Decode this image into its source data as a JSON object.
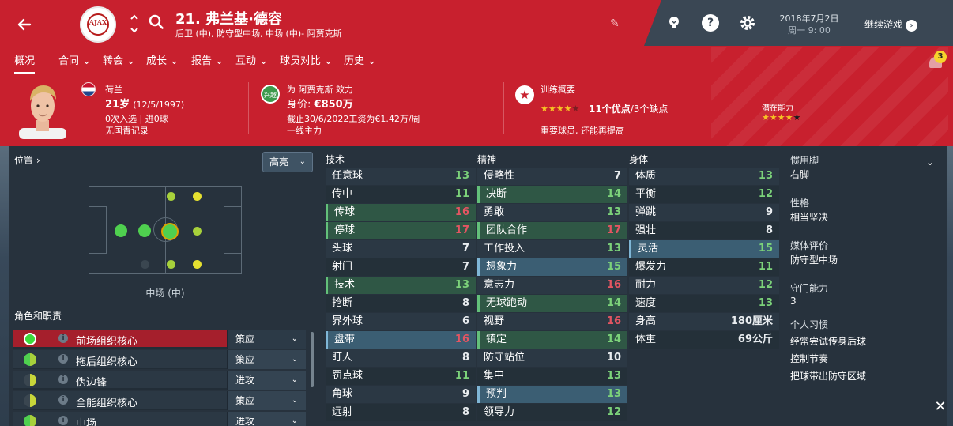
{
  "header": {
    "player_title": "21. 弗兰基·德容",
    "positions": "后卫 (中), 防守型中场, 中场 (中)- 阿贾克斯",
    "club_crest_text": "AJAX",
    "date": "2018年7月2日",
    "time": "周一 9: 00",
    "continue_label": "继续游戏",
    "notification_count": "3"
  },
  "nav": {
    "tabs": [
      {
        "label": "概况"
      },
      {
        "label": "合同"
      },
      {
        "label": "转会"
      },
      {
        "label": "成长"
      },
      {
        "label": "报告"
      },
      {
        "label": "互动"
      },
      {
        "label": "球员对比"
      },
      {
        "label": "历史"
      }
    ],
    "dropdown_glyph": "⌄"
  },
  "profile": {
    "nationality": "荷兰",
    "age": "21岁",
    "birth": "(12/5/1997)",
    "caps": "0次入选 | 进0球",
    "intl_record": "无国青记录",
    "plays_for": "为 阿贾克斯 效力",
    "value_label": "身价:",
    "value": "€850万",
    "contract": "截止30/6/2022工资为€1.42万/周",
    "squad_status": "一线主力",
    "club_badge_text": "兴趣",
    "training_label": "训练概要",
    "strengths": "11个优点",
    "weaknesses": "/3个缺点",
    "strength_stars": 4,
    "training_note": "重要球员, 还能再提高",
    "potential_label": "潜在能力",
    "potential_stars": 4
  },
  "left": {
    "position_label": "位置",
    "highlight_label": "高亮",
    "position_name": "中场 (中)",
    "roles_title": "角色和职责",
    "roles": [
      {
        "name": "前场组织核心",
        "duty": "策应"
      },
      {
        "name": "拖后组织核心",
        "duty": "策应"
      },
      {
        "name": "伪边锋",
        "duty": "进攻"
      },
      {
        "name": "全能组织核心",
        "duty": "策应"
      },
      {
        "name": "中场",
        "duty": "进攻"
      }
    ]
  },
  "columns": {
    "technical": "技术",
    "mental": "精神",
    "physical": "身体"
  },
  "technical": [
    {
      "name": "任意球",
      "value": "13"
    },
    {
      "name": "传中",
      "value": "11"
    },
    {
      "name": "传球",
      "value": "16"
    },
    {
      "name": "停球",
      "value": "17"
    },
    {
      "name": "头球",
      "value": "7"
    },
    {
      "name": "射门",
      "value": "7"
    },
    {
      "name": "技术",
      "value": "13"
    },
    {
      "name": "抢断",
      "value": "8"
    },
    {
      "name": "界外球",
      "value": "6"
    },
    {
      "name": "盘带",
      "value": "16"
    },
    {
      "name": "盯人",
      "value": "8"
    },
    {
      "name": "罚点球",
      "value": "11"
    },
    {
      "name": "角球",
      "value": "9"
    },
    {
      "name": "远射",
      "value": "8"
    }
  ],
  "mental": [
    {
      "name": "侵略性",
      "value": "7"
    },
    {
      "name": "决断",
      "value": "14"
    },
    {
      "name": "勇敢",
      "value": "13"
    },
    {
      "name": "团队合作",
      "value": "17"
    },
    {
      "name": "工作投入",
      "value": "13"
    },
    {
      "name": "想象力",
      "value": "15"
    },
    {
      "name": "意志力",
      "value": "16"
    },
    {
      "name": "无球跑动",
      "value": "14"
    },
    {
      "name": "视野",
      "value": "16"
    },
    {
      "name": "镇定",
      "value": "14"
    },
    {
      "name": "防守站位",
      "value": "10"
    },
    {
      "name": "集中",
      "value": "13"
    },
    {
      "name": "预判",
      "value": "13"
    },
    {
      "name": "领导力",
      "value": "12"
    }
  ],
  "physical": [
    {
      "name": "体质",
      "value": "13"
    },
    {
      "name": "平衡",
      "value": "12"
    },
    {
      "name": "弹跳",
      "value": "9"
    },
    {
      "name": "强壮",
      "value": "8"
    },
    {
      "name": "灵活",
      "value": "15"
    },
    {
      "name": "爆发力",
      "value": "11"
    },
    {
      "name": "耐力",
      "value": "12"
    },
    {
      "name": "速度",
      "value": "13"
    },
    {
      "name": "身高",
      "value": "180厘米"
    },
    {
      "name": "体重",
      "value": "69公斤"
    }
  ],
  "right": {
    "foot_label": "惯用脚",
    "foot_value": "右脚",
    "personality_label": "性格",
    "personality_value": "相当坚决",
    "media_label": "媒体评价",
    "media_value": "防守型中场",
    "gk_label": "守门能力",
    "gk_value": "3",
    "habits_label": "个人习惯",
    "habits": [
      "经常尝试传身后球",
      "控制节奏",
      "把球带出防守区域"
    ]
  },
  "colors": {
    "accent_red": "#c8202e",
    "good": "#7cd27a",
    "great": "#e35562",
    "panel": "#27323d"
  },
  "icons": [
    "back-arrow-icon",
    "up-down-icon",
    "search-icon",
    "pencil-icon",
    "lightbulb-icon",
    "help-icon",
    "gear-icon",
    "chevron-right-icon",
    "bell-icon",
    "star-icon",
    "info-icon",
    "close-icon"
  ]
}
